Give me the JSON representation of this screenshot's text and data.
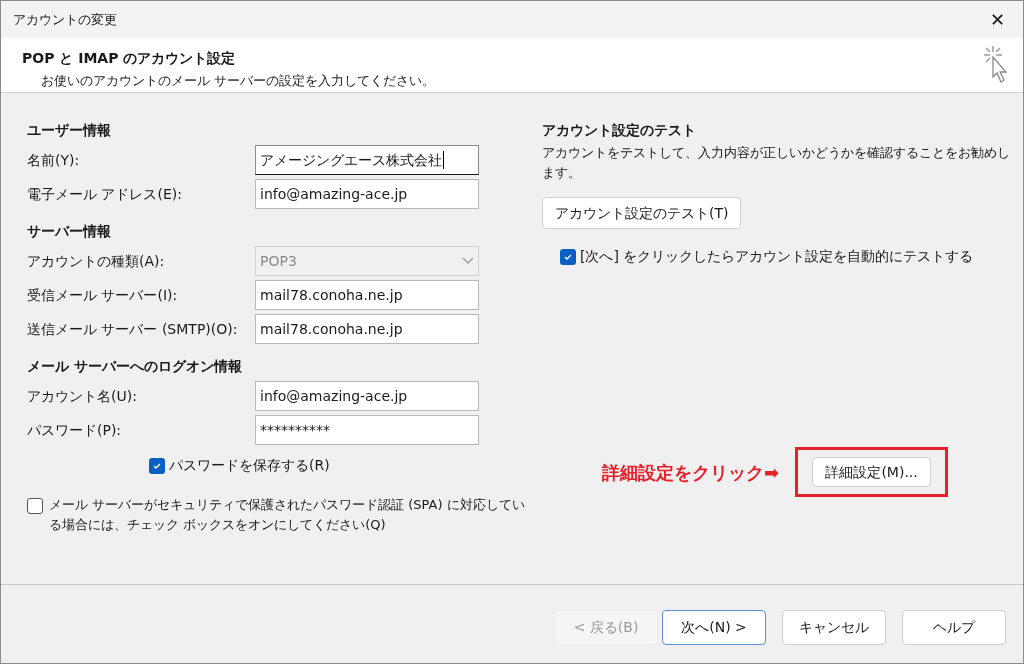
{
  "window": {
    "title": "アカウントの変更",
    "close": "✕"
  },
  "header": {
    "title": "POP と IMAP のアカウント設定",
    "subtitle": "お使いのアカウントのメール サーバーの設定を入力してください。"
  },
  "sections": [
    {
      "heading": "ユーザー情報",
      "fields": [
        {
          "kind": "text",
          "label": "名前(Y):",
          "value": "アメージングエース株式会社",
          "focused": true,
          "disabled": false
        },
        {
          "kind": "text",
          "label": "電子メール アドレス(E):",
          "value": "info@amazing-ace.jp",
          "focused": false,
          "disabled": false
        }
      ]
    },
    {
      "heading": "サーバー情報",
      "fields": [
        {
          "kind": "select",
          "label": "アカウントの種類(A):",
          "value": "POP3",
          "focused": false,
          "disabled": true
        },
        {
          "kind": "text",
          "label": "受信メール サーバー(I):",
          "value": "mail78.conoha.ne.jp",
          "focused": false,
          "disabled": false
        },
        {
          "kind": "text",
          "label": "送信メール サーバー (SMTP)(O):",
          "value": "mail78.conoha.ne.jp",
          "focused": false,
          "disabled": false
        }
      ]
    },
    {
      "heading": "メール サーバーへのログオン情報",
      "fields": [
        {
          "kind": "text",
          "label": "アカウント名(U):",
          "value": "info@amazing-ace.jp",
          "focused": false,
          "disabled": false
        },
        {
          "kind": "password",
          "label": "パスワード(P):",
          "value": "**********",
          "focused": false,
          "disabled": false
        }
      ]
    }
  ],
  "save_password": {
    "label": "パスワードを保存する(R)",
    "checked": true
  },
  "spa": {
    "label": "メール サーバーがセキュリティで保護されたパスワード認証 (SPA) に対応している場合には、チェック ボックスをオンにしてください(Q)",
    "checked": false
  },
  "test": {
    "heading": "アカウント設定のテスト",
    "description": "アカウントをテストして、入力内容が正しいかどうかを確認することをお勧めします。",
    "button": "アカウント設定のテスト(T)",
    "auto_test": {
      "label": "[次へ] をクリックしたらアカウント設定を自動的にテストする",
      "checked": true
    }
  },
  "annotation": {
    "text": "詳細設定をクリック➡"
  },
  "advanced_button": {
    "label": "詳細設定(M)..."
  },
  "footer_buttons": [
    {
      "label": "< 戻る(B)",
      "disabled": true,
      "default": false
    },
    {
      "label": "次へ(N) >",
      "disabled": false,
      "default": true
    },
    {
      "label": "キャンセル",
      "disabled": false,
      "default": false
    },
    {
      "label": "ヘルプ",
      "disabled": false,
      "default": false
    }
  ]
}
